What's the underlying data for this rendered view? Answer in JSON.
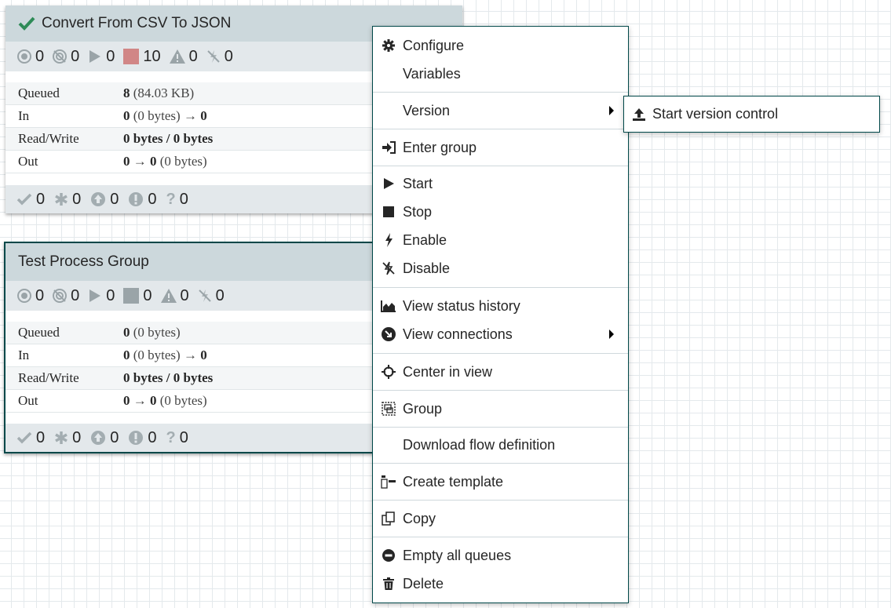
{
  "groups": [
    {
      "name": "Convert From CSV To JSON",
      "stats": {
        "transmitting": "0",
        "not_transmitting": "0",
        "running": "0",
        "stopped": "10",
        "invalid": "0",
        "disabled": "0"
      },
      "rows": [
        {
          "label": "Queued",
          "bold": "8",
          "rest": " (84.03 KB)"
        },
        {
          "label": "In",
          "bold": "0",
          "rest": " (0 bytes) → ",
          "bold2": "0"
        },
        {
          "label": "Read/Write",
          "bold": "0 bytes / 0 bytes",
          "rest": ""
        },
        {
          "label": "Out",
          "bold": "0",
          "rest": " → ",
          "bold2": "0",
          "rest2": " (0 bytes)"
        }
      ],
      "footer": {
        "up_to_date": "0",
        "locally_modified": "0",
        "stale": "0",
        "sync_failure": "0",
        "unknown": "0"
      }
    },
    {
      "name": "Test Process Group",
      "stats": {
        "transmitting": "0",
        "not_transmitting": "0",
        "running": "0",
        "stopped": "0",
        "invalid": "0",
        "disabled": "0"
      },
      "rows": [
        {
          "label": "Queued",
          "bold": "0",
          "rest": " (0 bytes)"
        },
        {
          "label": "In",
          "bold": "0",
          "rest": " (0 bytes) → ",
          "bold2": "0"
        },
        {
          "label": "Read/Write",
          "bold": "0 bytes / 0 bytes",
          "rest": ""
        },
        {
          "label": "Out",
          "bold": "0",
          "rest": " → ",
          "bold2": "0",
          "rest2": " (0 bytes)"
        }
      ],
      "footer": {
        "up_to_date": "0",
        "locally_modified": "0",
        "stale": "0",
        "sync_failure": "0",
        "unknown": "0"
      }
    }
  ],
  "menu": {
    "configure": "Configure",
    "variables": "Variables",
    "version": "Version",
    "enter_group": "Enter group",
    "start": "Start",
    "stop": "Stop",
    "enable": "Enable",
    "disable": "Disable",
    "view_status_history": "View status history",
    "view_connections": "View connections",
    "center_in_view": "Center in view",
    "group": "Group",
    "download_flow_definition": "Download flow definition",
    "create_template": "Create template",
    "copy": "Copy",
    "empty_all_queues": "Empty all queues",
    "delete": "Delete"
  },
  "submenu": {
    "start_version_control": "Start version control"
  },
  "colors": {
    "accent": "#004849",
    "stopped_red": "#d18686",
    "header_bg": "#ccd8dc",
    "stats_bg": "#e3e8eb",
    "valid_green": "#2e8b57"
  }
}
